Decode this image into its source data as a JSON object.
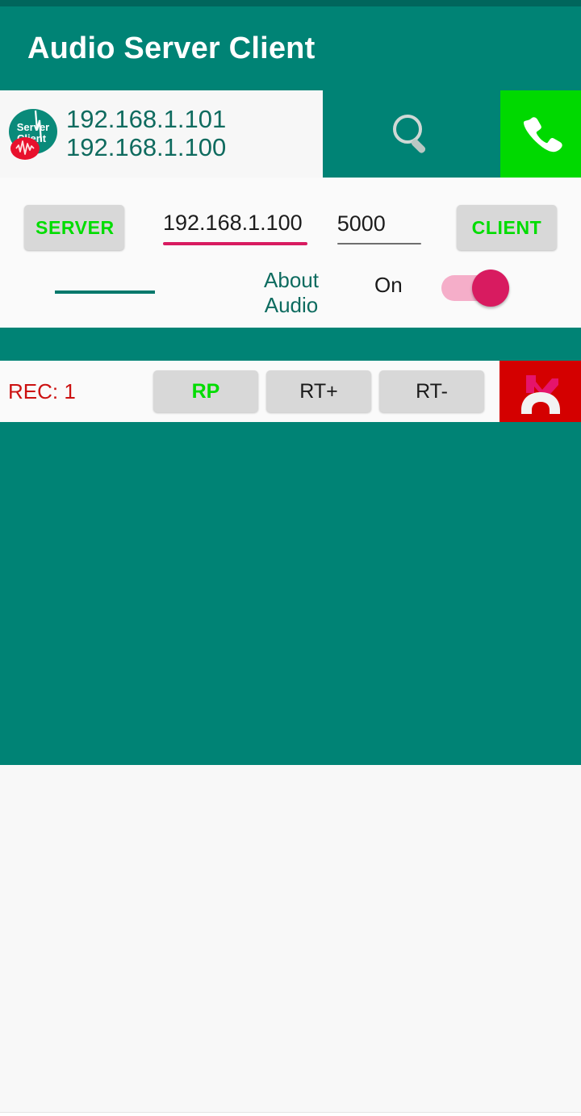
{
  "app": {
    "title": "Audio Server Client",
    "status_bar_color": "#00665c",
    "primary_color": "#008375"
  },
  "connection_bar": {
    "logo": {
      "icon": "server-client-logo",
      "line1": "Server",
      "line2": "Client"
    },
    "ip_addresses": [
      "192.168.1.101",
      "192.168.1.100"
    ],
    "search_icon": "search-icon",
    "call_button": {
      "icon": "phone-icon",
      "color": "#00d900"
    }
  },
  "controls": {
    "server_button": "SERVER",
    "client_button": "CLIENT",
    "ip_field": {
      "value": "192.168.1.100",
      "underline_color": "#d81b60"
    },
    "port_field": {
      "value": "5000",
      "underline_color": "#6e6e6e"
    },
    "spinner": {
      "value": ""
    },
    "about_link": "About Audio",
    "toggle": {
      "label": "On",
      "state": "on",
      "thumb_color": "#d81b60",
      "track_color": "#f5aec9"
    }
  },
  "recorder": {
    "rec_label": "REC: 1",
    "rec_label_color": "#cc1111",
    "buttons": [
      {
        "label": "RP",
        "color": "#00dd00"
      },
      {
        "label": "RT+",
        "color": "#1a1a1a"
      },
      {
        "label": "RT-",
        "color": "#1a1a1a"
      }
    ],
    "end_call_button": {
      "icon": "end-call-icon",
      "color": "#d40000"
    }
  }
}
